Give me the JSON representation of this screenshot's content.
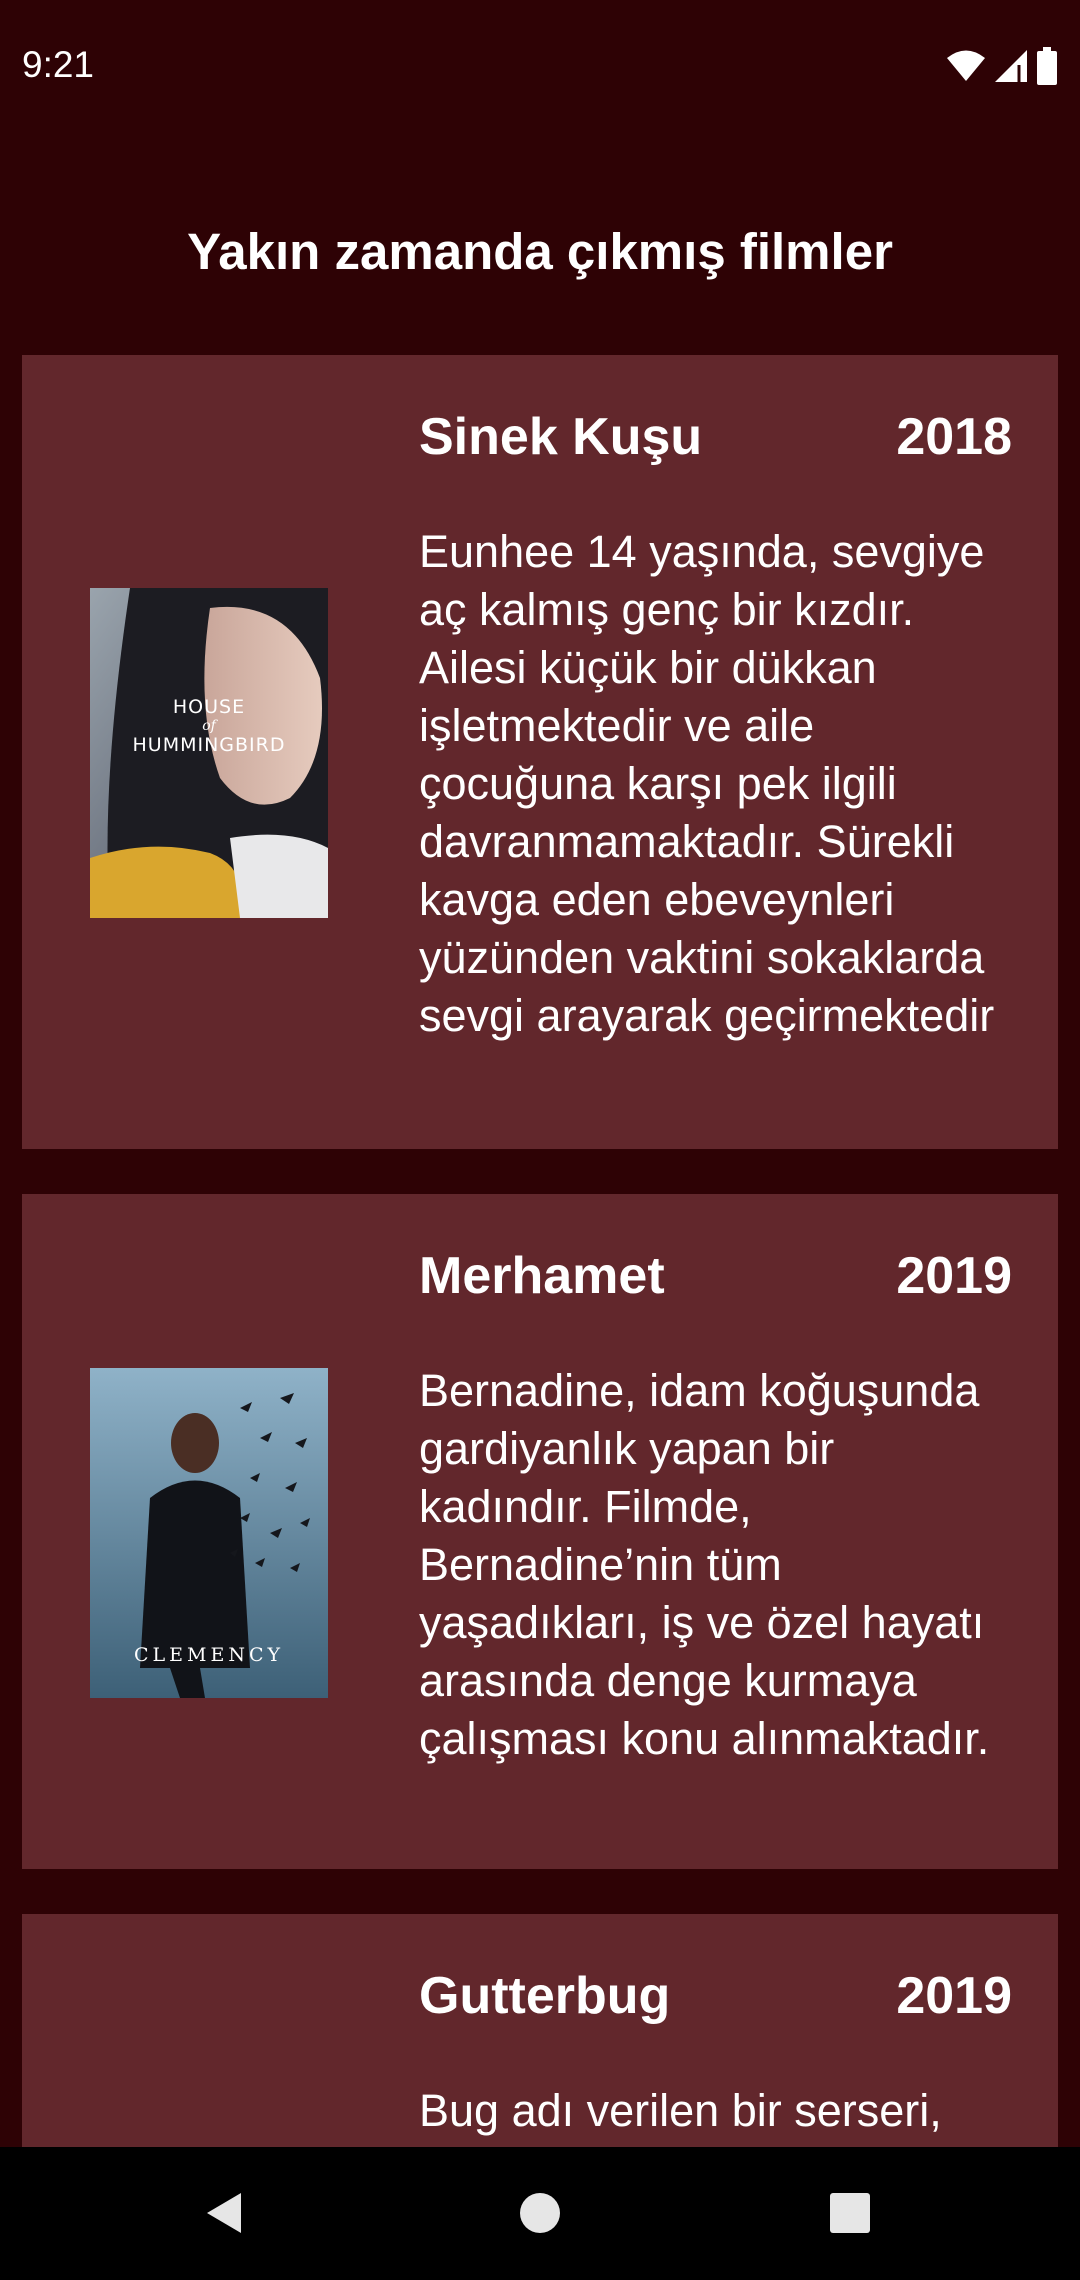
{
  "status_bar": {
    "time": "9:21",
    "icons": [
      "wifi-icon",
      "signal-icon",
      "battery-icon"
    ]
  },
  "page": {
    "title": "Yakın zamanda çıkmış filmler"
  },
  "movies": [
    {
      "title": "Sinek Kuşu",
      "year": "2018",
      "description": "Eunhee 14 yaşında, sevgiye aç kalmış genç bir kızdır. Ailesi küçük bir dükkan işletmektedir ve aile çocuğuna karşı pek ilgili davranmamaktadır. Sürekli kavga eden ebeveynleri yüzünden vaktini sokaklarda sevgi arayarak geçirmektedir",
      "poster": {
        "line1": "HOUSE",
        "line2": "of",
        "line3": "HUMMINGBIRD"
      }
    },
    {
      "title": "Merhamet",
      "year": "2019",
      "description": "Bernadine, idam koğuşunda gardiyanlık yapan bir kadındır. Filmde, Bernadine’nin tüm yaşadıkları, iş ve özel hayatı arasında denge kurmaya çalışması konu alınmaktadır.",
      "poster": {
        "line1": "CLEMENCY"
      }
    },
    {
      "title": "Gutterbug",
      "year": "2019",
      "description": "Bug adı verilen bir serseri,"
    }
  ],
  "nav_bar": {
    "buttons": [
      "back-icon",
      "home-icon",
      "recents-icon"
    ]
  },
  "colors": {
    "background": "#2e0205",
    "card": "#62272c",
    "text": "#ffffff",
    "nav_bar": "#000000"
  }
}
